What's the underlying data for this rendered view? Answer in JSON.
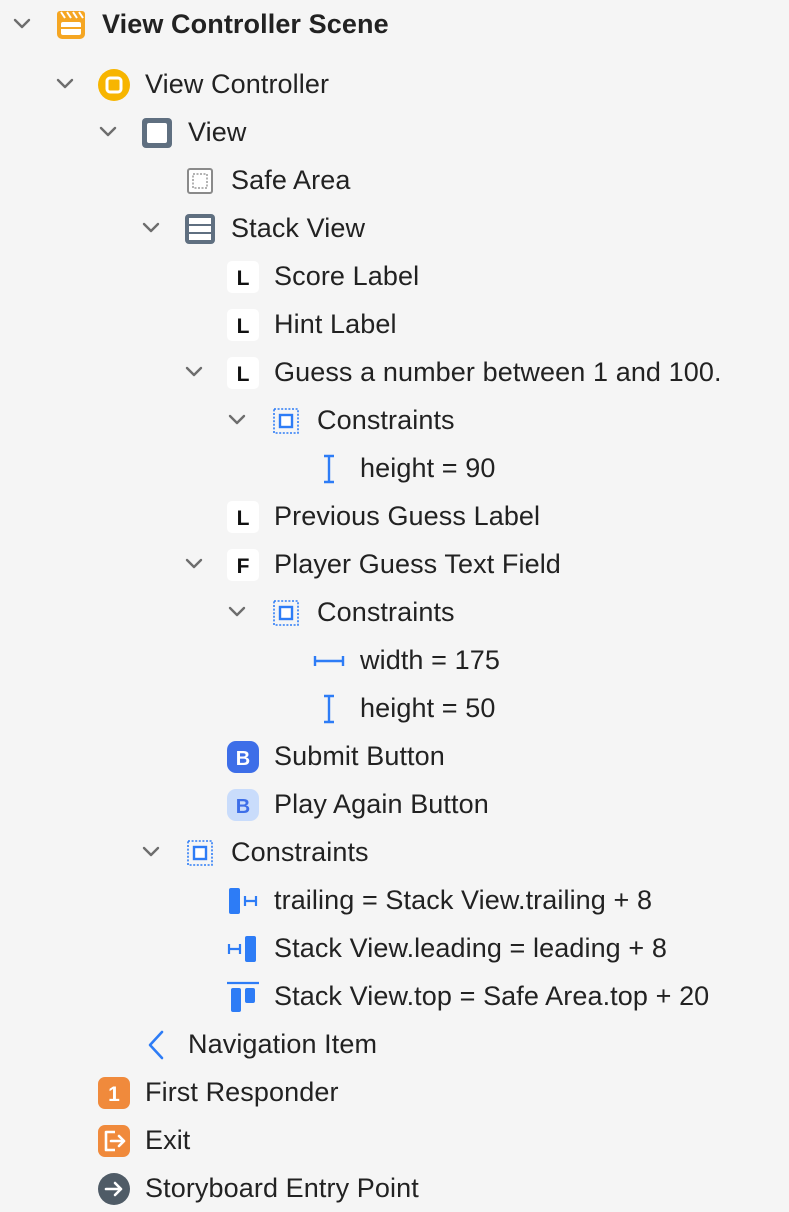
{
  "outline": {
    "rows": [
      {
        "id": "r0",
        "label": "View Controller Scene",
        "icon": "storyboard-scene-icon",
        "disclosure": "expanded",
        "bold": true
      },
      {
        "id": "r1",
        "label": "View Controller",
        "icon": "view-controller-icon",
        "disclosure": "expanded"
      },
      {
        "id": "r2",
        "label": "View",
        "icon": "view-icon",
        "disclosure": "expanded"
      },
      {
        "id": "r3",
        "label": "Safe Area",
        "icon": "safe-area-icon",
        "disclosure": "none"
      },
      {
        "id": "r4",
        "label": "Stack View",
        "icon": "stack-view-icon",
        "disclosure": "expanded"
      },
      {
        "id": "r5",
        "label": "Score Label",
        "icon": "label-icon",
        "disclosure": "none"
      },
      {
        "id": "r6",
        "label": "Hint Label",
        "icon": "label-icon",
        "disclosure": "none"
      },
      {
        "id": "r7",
        "label": "Guess a number between 1 and 100.",
        "icon": "label-icon",
        "disclosure": "expanded"
      },
      {
        "id": "r8",
        "label": "Constraints",
        "icon": "constraints-icon",
        "disclosure": "expanded"
      },
      {
        "id": "r9",
        "label": "height = 90",
        "icon": "height-constraint-icon",
        "disclosure": "none"
      },
      {
        "id": "r10",
        "label": "Previous Guess Label",
        "icon": "label-icon",
        "disclosure": "none"
      },
      {
        "id": "r11",
        "label": "Player Guess Text Field",
        "icon": "text-field-icon",
        "disclosure": "expanded"
      },
      {
        "id": "r12",
        "label": "Constraints",
        "icon": "constraints-icon",
        "disclosure": "expanded"
      },
      {
        "id": "r13",
        "label": "width = 175",
        "icon": "width-constraint-icon",
        "disclosure": "none"
      },
      {
        "id": "r14",
        "label": "height = 50",
        "icon": "height-constraint-icon",
        "disclosure": "none"
      },
      {
        "id": "r15",
        "label": "Submit Button",
        "icon": "button-icon",
        "disclosure": "none"
      },
      {
        "id": "r16",
        "label": "Play Again Button",
        "icon": "button-light-icon",
        "disclosure": "none"
      },
      {
        "id": "r17",
        "label": "Constraints",
        "icon": "constraints-icon",
        "disclosure": "expanded"
      },
      {
        "id": "r18",
        "label": "trailing = Stack View.trailing + 8",
        "icon": "trailing-constraint-icon",
        "disclosure": "none"
      },
      {
        "id": "r19",
        "label": "Stack View.leading = leading + 8",
        "icon": "leading-constraint-icon",
        "disclosure": "none"
      },
      {
        "id": "r20",
        "label": "Stack View.top = Safe Area.top + 20",
        "icon": "top-constraint-icon",
        "disclosure": "none"
      },
      {
        "id": "r21",
        "label": "Navigation Item",
        "icon": "navigation-item-icon",
        "disclosure": "none"
      },
      {
        "id": "r22",
        "label": "First Responder",
        "icon": "first-responder-icon",
        "disclosure": "none"
      },
      {
        "id": "r23",
        "label": "Exit",
        "icon": "exit-icon",
        "disclosure": "none"
      },
      {
        "id": "r24",
        "label": "Storyboard Entry Point",
        "icon": "storyboard-entry-point-icon",
        "disclosure": "none"
      }
    ]
  },
  "badges": {
    "label": "L",
    "text_field": "F",
    "button": "B",
    "first_responder": "1"
  },
  "colors": {
    "scene_orange": "#f5a623",
    "view_controller_yellow": "#f7b500",
    "view_gray": "#5f6f80",
    "constraint_blue": "#2d7cf6",
    "button_blue": "#3d6ee8",
    "button_light": "#c9dcfb",
    "responder_orange": "#f08a3c",
    "entry_gray": "#4f5b66",
    "chevron_gray": "#6d6d6d"
  }
}
